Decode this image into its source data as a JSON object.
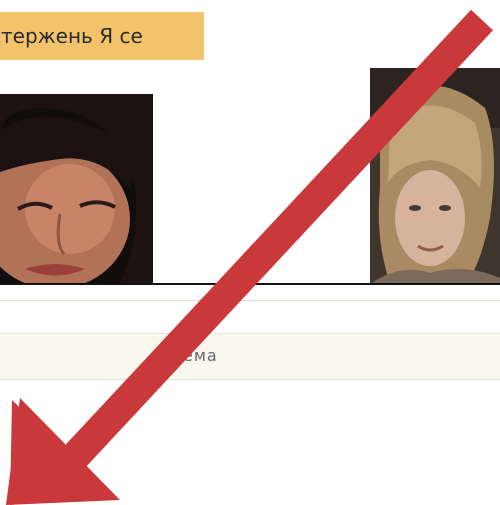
{
  "header": {
    "highlight_text": "тержень Я се"
  },
  "section": {
    "label": "ема"
  },
  "colors": {
    "highlight_bg": "#f3c36b",
    "arrow": "#c9393b",
    "section_bg": "#f7f7ee"
  },
  "icons": {
    "arrow": "arrow-down-left-icon"
  }
}
